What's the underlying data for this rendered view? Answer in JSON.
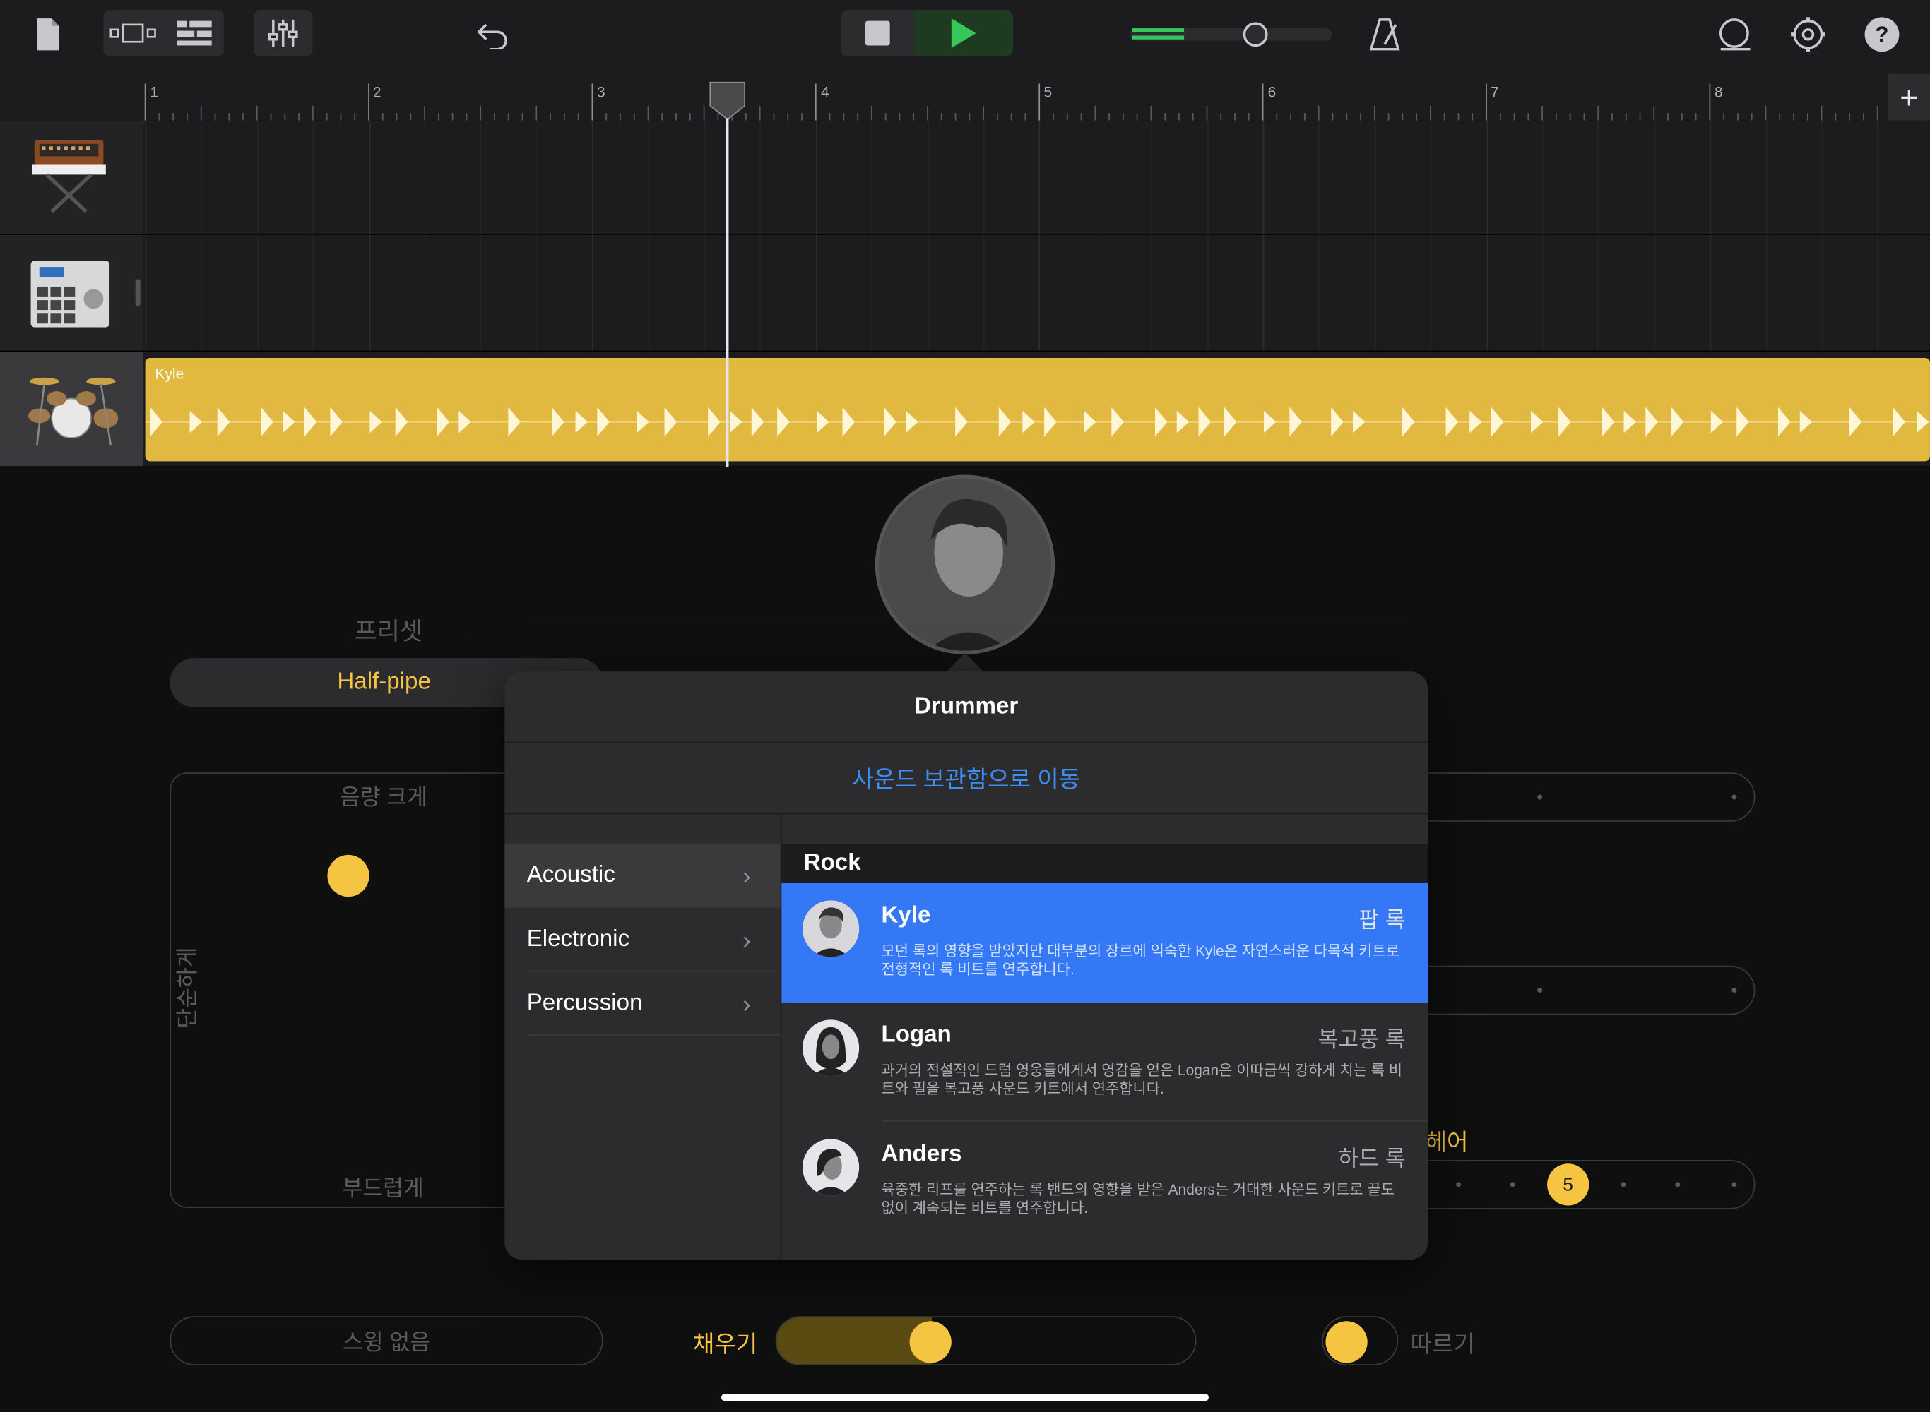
{
  "toolbar": {
    "icons": [
      "document-icon",
      "track-view-icon",
      "tracks-list-icon",
      "mixer-icon",
      "undo-icon",
      "stop-icon",
      "play-icon",
      "master-volume-slider",
      "metronome-icon",
      "loop-icon",
      "settings-icon",
      "help-icon"
    ],
    "help_label": "?",
    "accent_play": "#35c759"
  },
  "ruler": {
    "bars": [
      "1",
      "2",
      "3",
      "4",
      "5",
      "6",
      "7",
      "8"
    ],
    "add_label": "+"
  },
  "tracks": [
    {
      "instrument": "synth-keyboard"
    },
    {
      "instrument": "drum-machine"
    },
    {
      "instrument": "drum-kit",
      "region_label": "Kyle",
      "region_color": "#e2b940"
    }
  ],
  "drummer": {
    "preset_label": "프리셋",
    "preset_value": "Half-pipe",
    "loud_label": "음량 크게",
    "soft_label": "부드럽게",
    "simple_label": "단순하게",
    "swing_label": "스윙 없음",
    "fill_label": "채우기",
    "follow_label": "따르기",
    "hihat_label_partial": "헤어",
    "knob_value": "5",
    "accent": "#f5c542"
  },
  "popover": {
    "title": "Drummer",
    "library_link": "사운드 보관함으로 이동",
    "categories": [
      {
        "label": "Acoustic",
        "selected": true
      },
      {
        "label": "Electronic",
        "selected": false
      },
      {
        "label": "Percussion",
        "selected": false
      }
    ],
    "section_header": "Rock",
    "drummers": [
      {
        "name": "Kyle",
        "genre": "팝 록",
        "desc": "모던 록의 영향을 받았지만 대부분의 장르에 익숙한 Kyle은 자연스러운 다목적 키트로 전형적인 록 비트를 연주합니다.",
        "selected": true
      },
      {
        "name": "Logan",
        "genre": "복고풍 록",
        "desc": "과거의 전설적인 드럼 영웅들에게서 영감을 얻은 Logan은 이따금씩 강하게 치는 록 비트와 필을 복고풍 사운드 키트에서 연주합니다.",
        "selected": false
      },
      {
        "name": "Anders",
        "genre": "하드 록",
        "desc": "육중한 리프를 연주하는 록 밴드의 영향을 받은 Anders는 거대한 사운드 키트로 끝도 없이 계속되는 비트를 연주합니다.",
        "selected": false
      }
    ],
    "selected_color": "#3478f6",
    "link_color": "#3d8ef5"
  }
}
